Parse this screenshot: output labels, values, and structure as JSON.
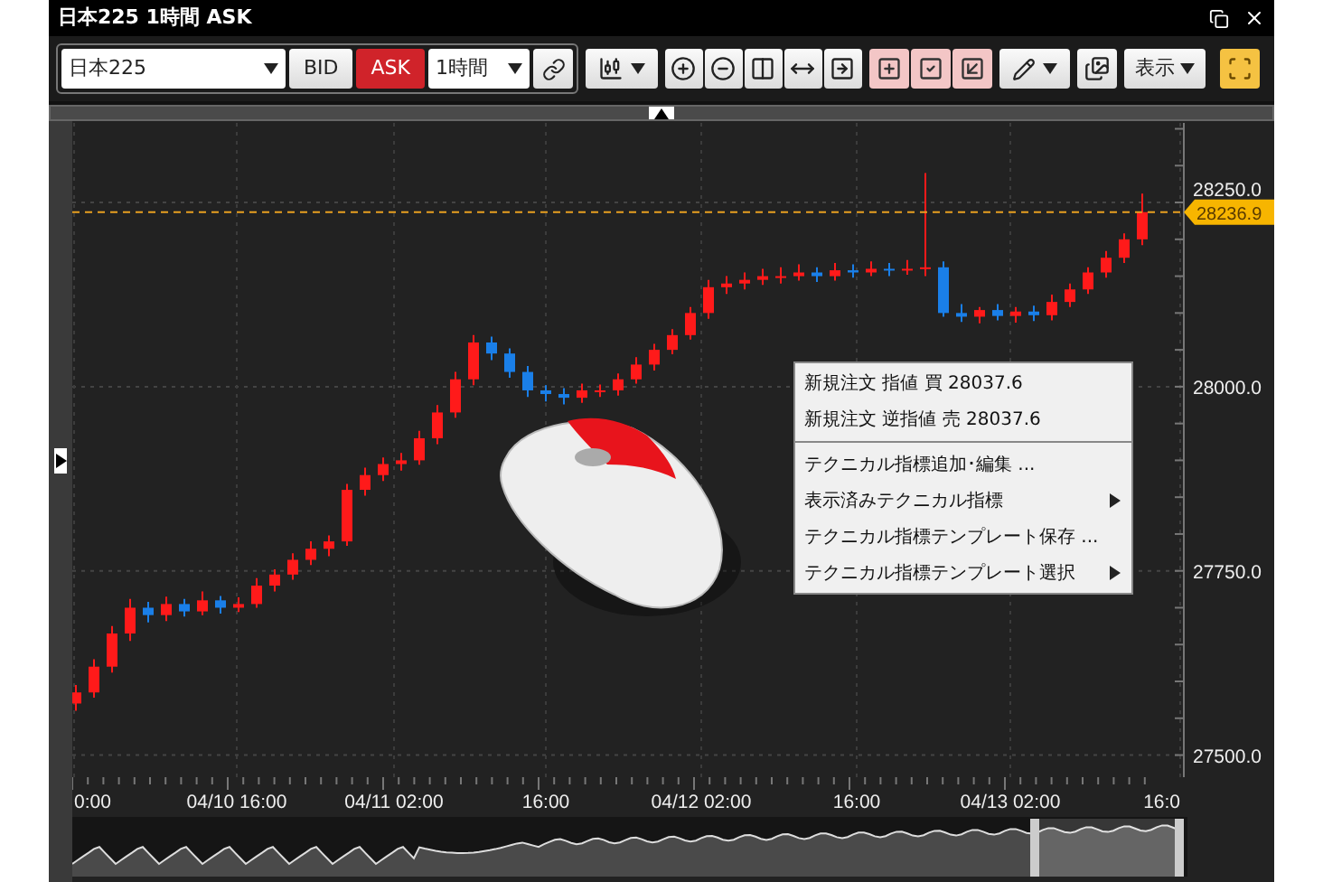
{
  "window": {
    "title": "日本225 1時間 ASK"
  },
  "toolbar": {
    "symbol": "日本225",
    "sides": [
      {
        "label": "BID",
        "selected": false
      },
      {
        "label": "ASK",
        "selected": true
      }
    ],
    "interval": "1時間",
    "display_button": "表示"
  },
  "chart": {
    "chart_data": {
      "type": "candlestick",
      "ylim": [
        27470,
        28358
      ],
      "grid": true,
      "ref_lines": [
        {
          "axis": "y",
          "value": 28236.9,
          "label": "28236.9",
          "color": "#e8a020"
        }
      ],
      "yticks": [
        {
          "value": 28250,
          "label": "28250.0"
        },
        {
          "value": 28000,
          "label": "28000.0"
        },
        {
          "value": 27750,
          "label": "27750.0"
        },
        {
          "value": 27500,
          "label": "27500.0"
        }
      ],
      "ohlc": [
        [
          27570,
          27595,
          27560,
          27585
        ],
        [
          27585,
          27630,
          27578,
          27620
        ],
        [
          27620,
          27675,
          27612,
          27665
        ],
        [
          27665,
          27712,
          27655,
          27700
        ],
        [
          27700,
          27708,
          27680,
          27690
        ],
        [
          27690,
          27715,
          27682,
          27705
        ],
        [
          27705,
          27712,
          27688,
          27695
        ],
        [
          27695,
          27722,
          27690,
          27710
        ],
        [
          27710,
          27716,
          27692,
          27700
        ],
        [
          27700,
          27714,
          27694,
          27705
        ],
        [
          27705,
          27740,
          27700,
          27730
        ],
        [
          27730,
          27752,
          27722,
          27745
        ],
        [
          27745,
          27774,
          27738,
          27765
        ],
        [
          27765,
          27790,
          27758,
          27780
        ],
        [
          27780,
          27798,
          27770,
          27790
        ],
        [
          27790,
          27868,
          27784,
          27860
        ],
        [
          27860,
          27890,
          27852,
          27880
        ],
        [
          27880,
          27904,
          27872,
          27895
        ],
        [
          27895,
          27910,
          27886,
          27900
        ],
        [
          27900,
          27940,
          27894,
          27930
        ],
        [
          27930,
          27975,
          27922,
          27965
        ],
        [
          27965,
          28020,
          27958,
          28010
        ],
        [
          28010,
          28070,
          28002,
          28060
        ],
        [
          28060,
          28068,
          28036,
          28045
        ],
        [
          28045,
          28052,
          28012,
          28020
        ],
        [
          28020,
          28028,
          27986,
          27995
        ],
        [
          27995,
          28002,
          27980,
          27990
        ],
        [
          27990,
          27998,
          27976,
          27985
        ],
        [
          27985,
          28004,
          27978,
          27995
        ],
        [
          27995,
          28003,
          27986,
          27995
        ],
        [
          27995,
          28018,
          27988,
          28010
        ],
        [
          28010,
          28040,
          28004,
          28030
        ],
        [
          28030,
          28058,
          28022,
          28050
        ],
        [
          28050,
          28078,
          28044,
          28070
        ],
        [
          28070,
          28108,
          28064,
          28100
        ],
        [
          28100,
          28145,
          28092,
          28135
        ],
        [
          28135,
          28150,
          28126,
          28140
        ],
        [
          28140,
          28155,
          28132,
          28145
        ],
        [
          28145,
          28160,
          28138,
          28150
        ],
        [
          28150,
          28162,
          28140,
          28150
        ],
        [
          28150,
          28166,
          28144,
          28155
        ],
        [
          28155,
          28162,
          28142,
          28150
        ],
        [
          28150,
          28168,
          28144,
          28158
        ],
        [
          28158,
          28166,
          28148,
          28155
        ],
        [
          28155,
          28170,
          28150,
          28160
        ],
        [
          28160,
          28168,
          28150,
          28158
        ],
        [
          28158,
          28172,
          28152,
          28160
        ],
        [
          28160,
          28290,
          28150,
          28162
        ],
        [
          28162,
          28170,
          28095,
          28100
        ],
        [
          28100,
          28112,
          28088,
          28095
        ],
        [
          28095,
          28108,
          28086,
          28104
        ],
        [
          28104,
          28112,
          28090,
          28096
        ],
        [
          28096,
          28108,
          28087,
          28102
        ],
        [
          28102,
          28110,
          28089,
          28097
        ],
        [
          28097,
          28125,
          28090,
          28115
        ],
        [
          28115,
          28140,
          28108,
          28132
        ],
        [
          28132,
          28162,
          28126,
          28155
        ],
        [
          28155,
          28184,
          28148,
          28175
        ],
        [
          28175,
          28208,
          28168,
          28200
        ],
        [
          28200,
          28262,
          28192,
          28236.9
        ]
      ]
    },
    "time_axis": [
      "0:00",
      "04/10 16:00",
      "04/11 02:00",
      "16:00",
      "04/12 02:00",
      "16:00",
      "04/13 02:00",
      "16:0"
    ]
  },
  "context_menu": {
    "sections": [
      [
        {
          "label": "新規注文 指値 買 28037.6",
          "submenu": false
        },
        {
          "label": "新規注文 逆指値 売 28037.6",
          "submenu": false
        }
      ],
      [
        {
          "label": "テクニカル指標追加･編集 ...",
          "submenu": false
        },
        {
          "label": "表示済みテクニカル指標",
          "submenu": true
        },
        {
          "label": "テクニカル指標テンプレート保存 ...",
          "submenu": false
        },
        {
          "label": "テクニカル指標テンプレート選択",
          "submenu": true
        }
      ]
    ]
  }
}
